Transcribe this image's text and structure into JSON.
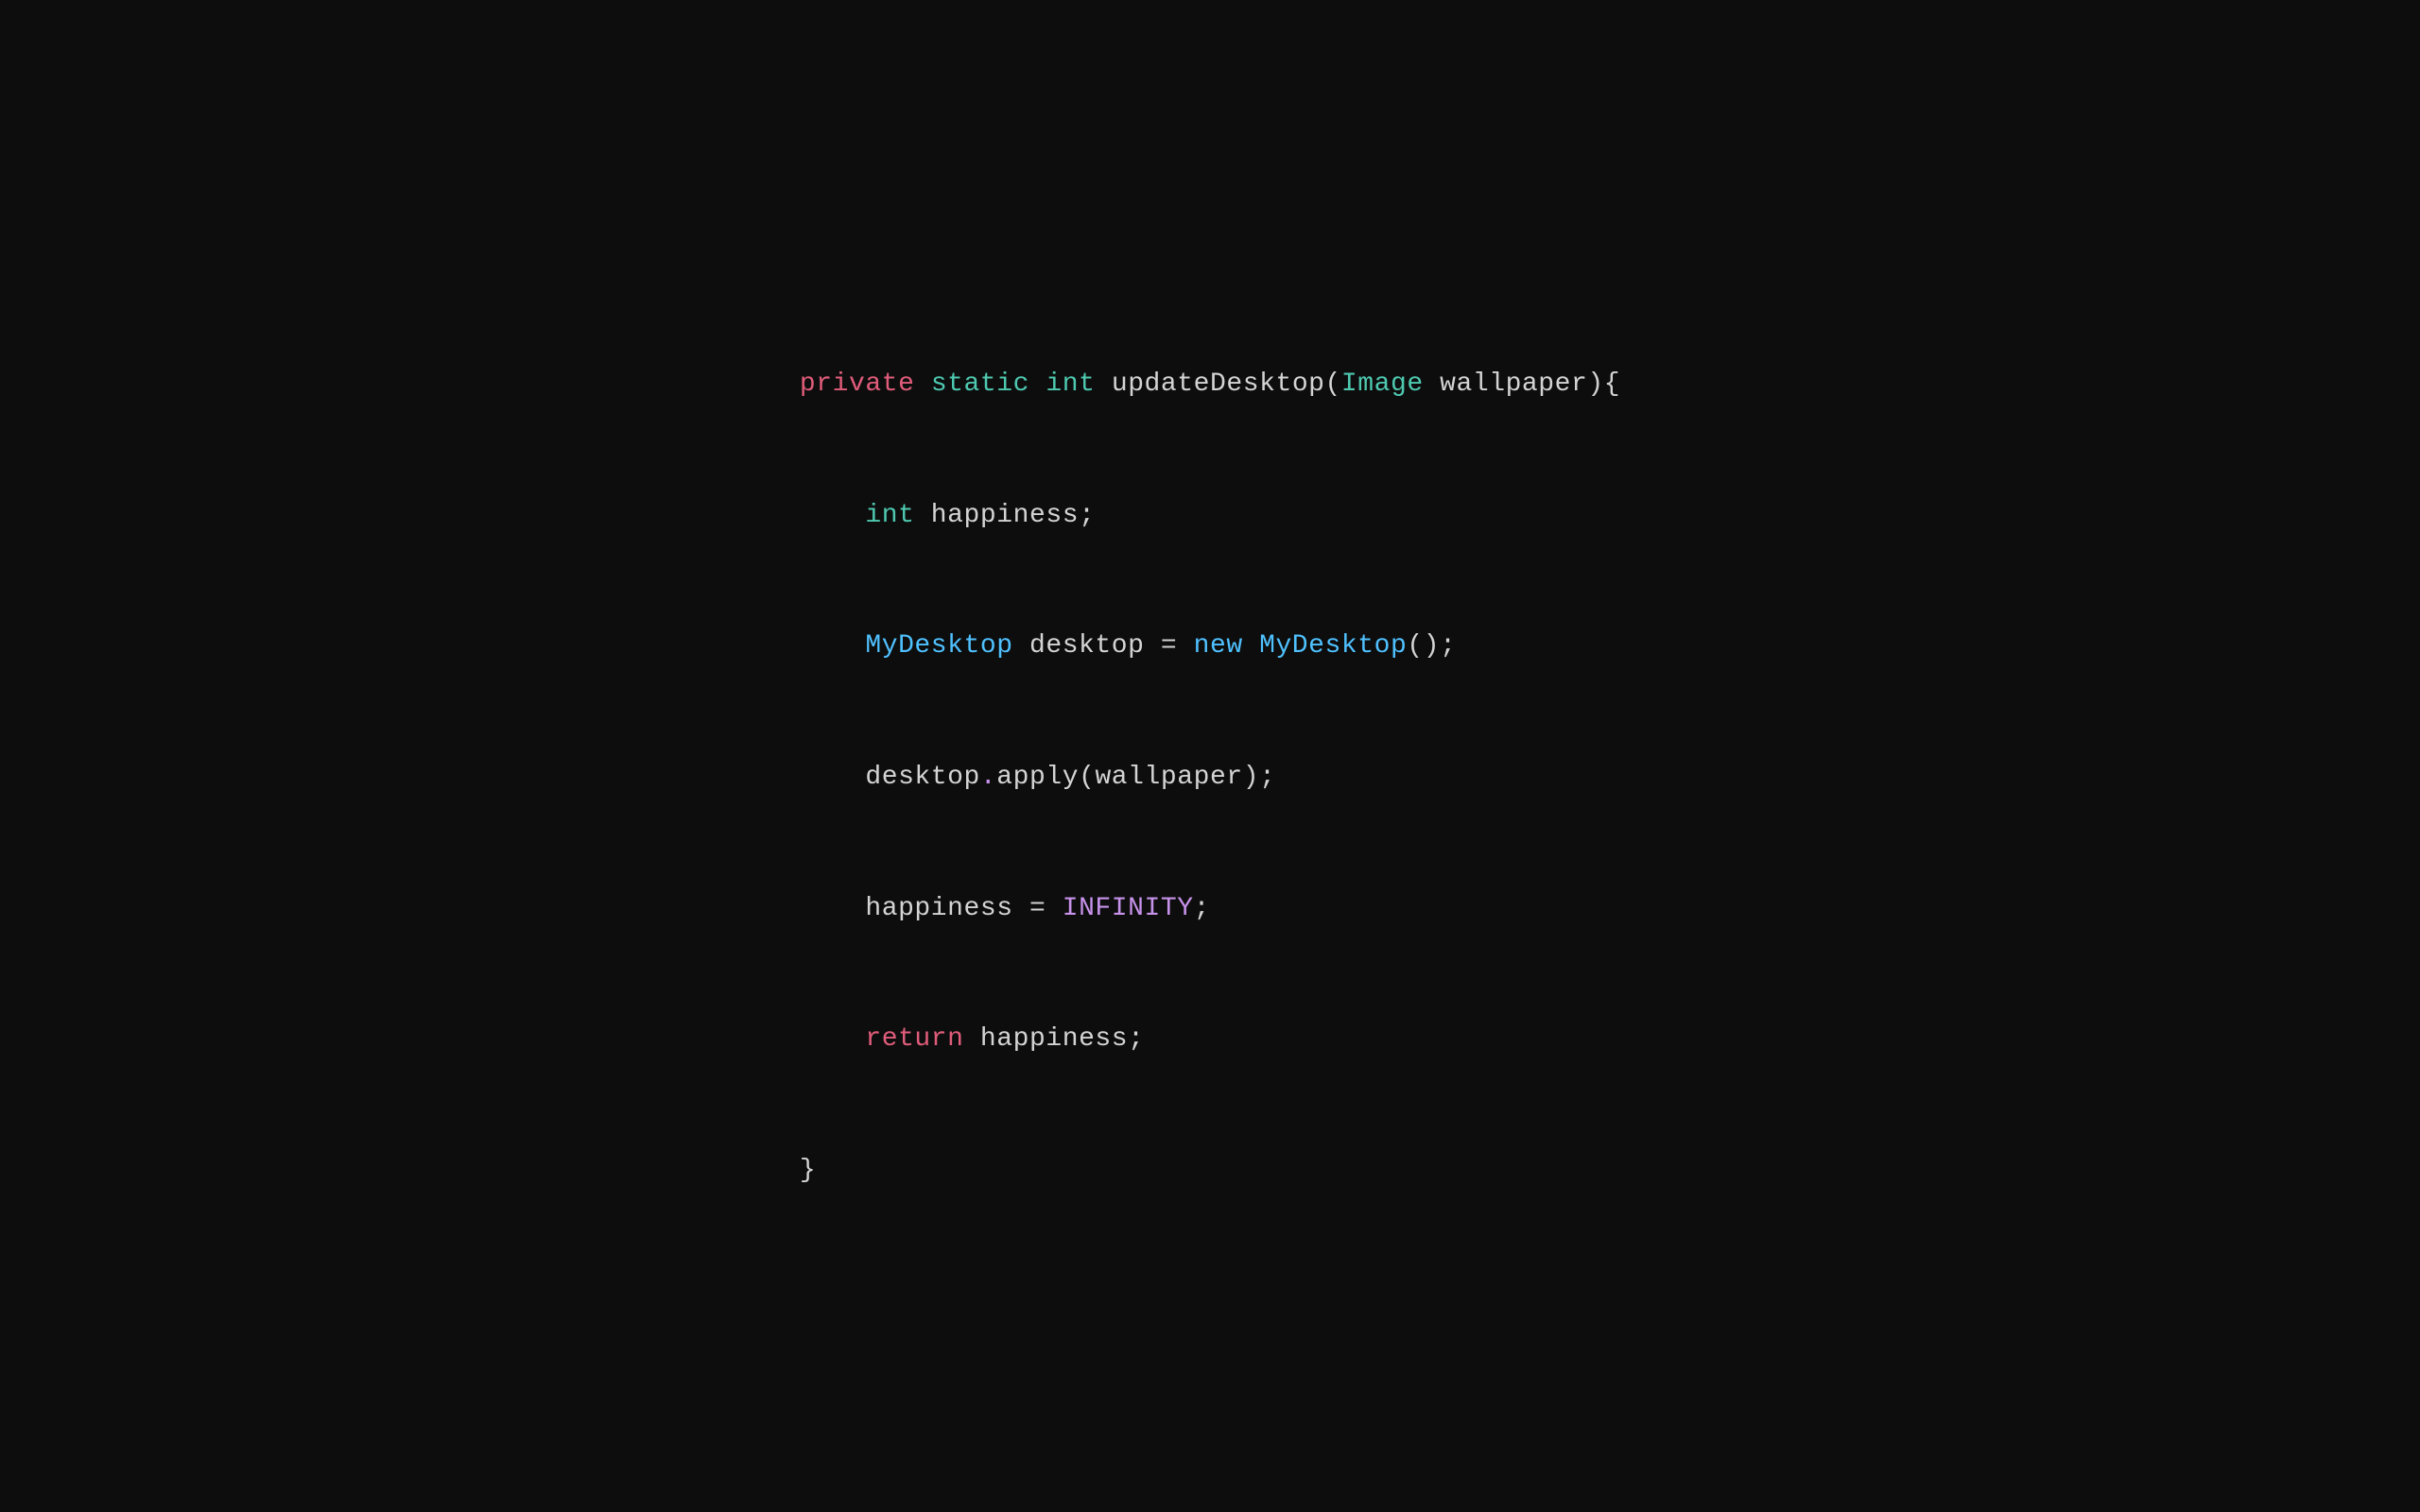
{
  "background": "#0d0d0d",
  "code": {
    "line1": {
      "private": "private",
      "space1": " ",
      "static": "static",
      "space2": " ",
      "int": "int",
      "rest": " updateDesktop(",
      "image": "Image",
      "param": " wallpaper){"
    },
    "line2": {
      "indent": "    ",
      "int": "int",
      "rest": " happiness;"
    },
    "line3": {
      "indent": "    ",
      "mydesktop1": "MyDesktop",
      "rest1": " desktop = ",
      "new": "new",
      "space": " ",
      "mydesktop2": "MyDesktop",
      "rest2": "();"
    },
    "line4": {
      "indent": "    ",
      "rest": "desktop",
      "dot": ".",
      "rest2": "apply(wallpaper);"
    },
    "line5": {
      "indent": "    ",
      "rest1": "happiness = ",
      "infinity": "INFINITY",
      "rest2": ";"
    },
    "line6": {
      "indent": "    ",
      "return": "return",
      "rest": " happiness;"
    },
    "line7": {
      "brace": "}"
    }
  }
}
